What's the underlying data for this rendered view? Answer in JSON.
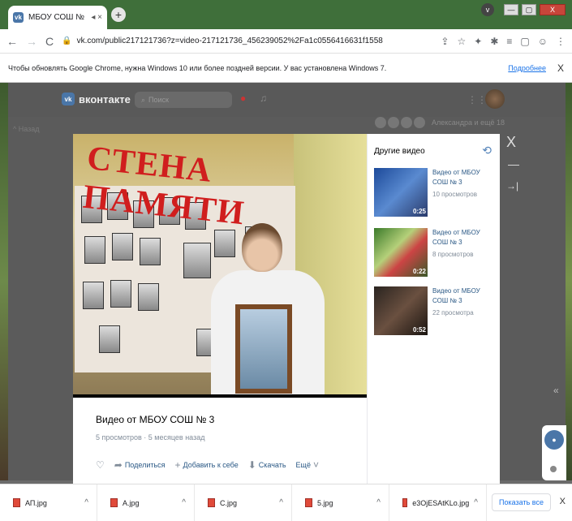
{
  "browser": {
    "tab_title": "МБОУ СОШ № 3",
    "new_tab": "+",
    "url": "vk.com/public217121736?z=video-217121736_456239052%2Fa1c0556416631f1558",
    "back": "←",
    "forward": "→",
    "reload": "C",
    "lock": "🔒",
    "ext_icons": [
      "⇪",
      "☆",
      "✦",
      "✱",
      "≡",
      "▢",
      "☺",
      "⋮"
    ],
    "profile": "v",
    "win_min": "—",
    "win_max": "▢",
    "win_close": "X"
  },
  "infobar": {
    "message": "Чтобы обновлять Google Chrome, нужна Windows 10 или более поздней версии. У вас установлена Windows 7.",
    "more": "Подробнее",
    "close": "X"
  },
  "vk": {
    "logo": "вконтакте",
    "logo_mark": "vk",
    "search_placeholder": "Поиск",
    "back": "^ Назад",
    "friends_text": "Александра и ещё 18"
  },
  "video": {
    "banner": "СТЕНА ПАМЯТИ",
    "title": "Видео от МБОУ СОШ № 3",
    "meta": "5 просмотров · 5 месяцев назад",
    "actions": {
      "like_icon": "♡",
      "share": "Поделиться",
      "add": "Добавить к себе",
      "download": "Скачать",
      "more": "Ещё"
    }
  },
  "sidebar": {
    "title": "Другие видео",
    "items": [
      {
        "title": "Видео от МБОУ СОШ № 3",
        "views": "10 просмотров",
        "duration": "0:25"
      },
      {
        "title": "Видео от МБОУ СОШ № 3",
        "views": "8 просмотров",
        "duration": "0:22"
      },
      {
        "title": "Видео от МБОУ СОШ № 3",
        "views": "22 просмотра",
        "duration": "0:52"
      }
    ]
  },
  "overlay": {
    "close": "X",
    "minimize": "—",
    "dock": "→|",
    "collapse": "«"
  },
  "downloads": {
    "files": [
      "АП.jpg",
      "А.jpg",
      "С.jpg",
      "5.jpg",
      "e3OjESAtKLo.jpg"
    ],
    "show_all": "Показать все",
    "close": "X"
  },
  "colors": {
    "vk_blue": "#4a76a8",
    "link": "#2a5885",
    "muted": "#818c99"
  }
}
